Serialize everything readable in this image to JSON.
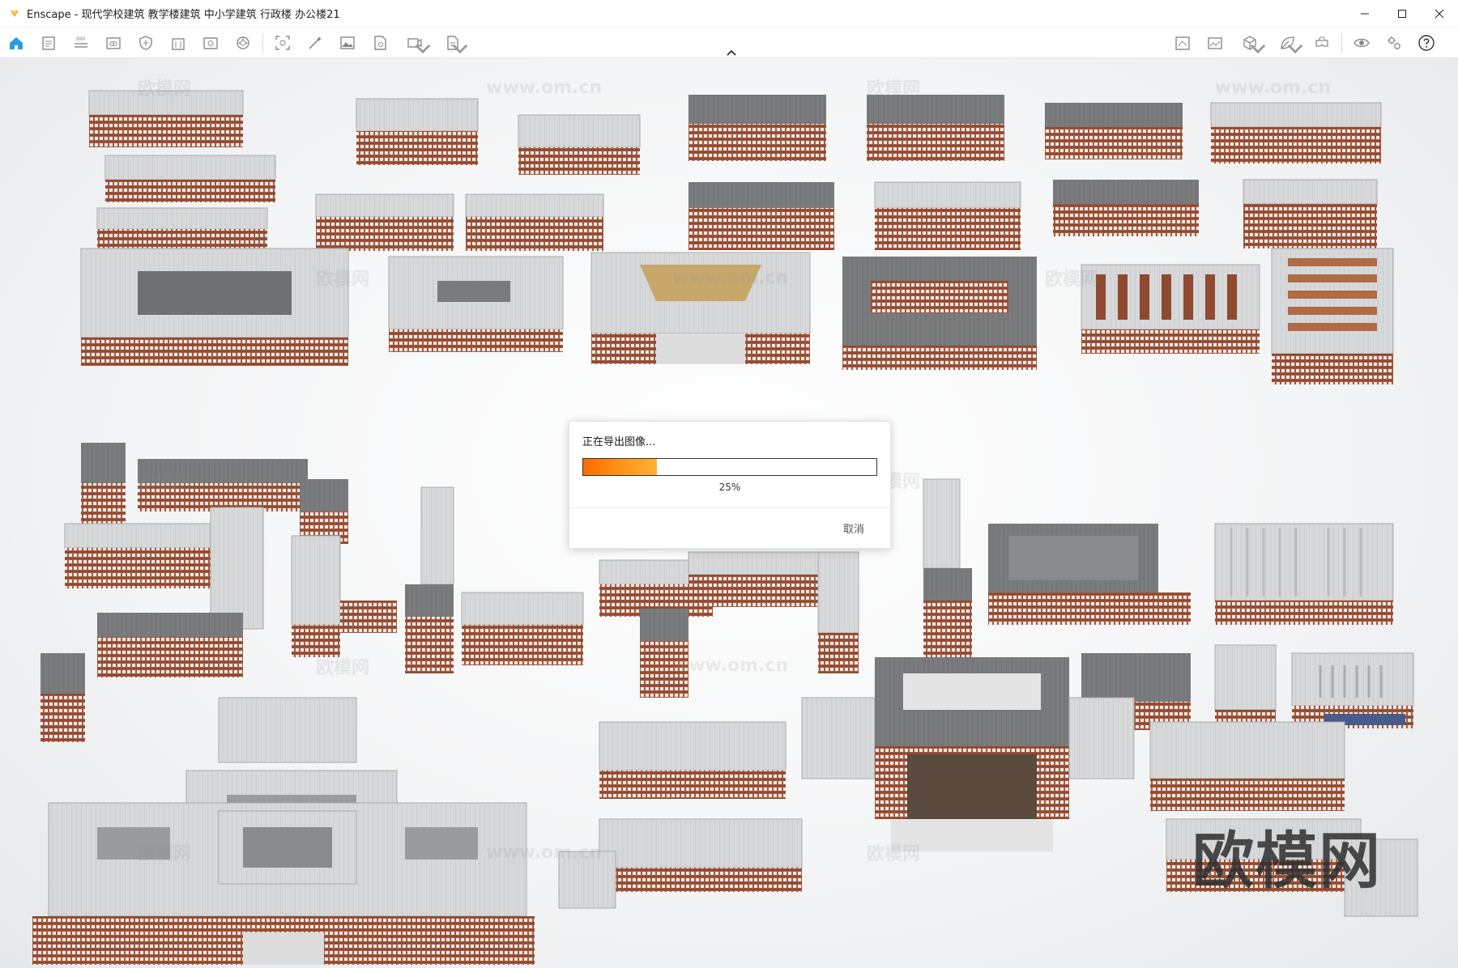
{
  "window": {
    "title": "Enscape - 现代学校建筑 教学楼建筑 中小学建筑 行政楼 办公楼21"
  },
  "icons": {
    "app": "enscape-logo-icon",
    "minimize": "minimize-icon",
    "maximize": "maximize-icon",
    "close": "close-icon",
    "collapse": "chevron-up-icon"
  },
  "toolbar": {
    "left_icons": [
      "home-icon",
      "document-icon",
      "bim-icon",
      "view-eye-icon",
      "shield-icon",
      "building-icon",
      "export-icon",
      "settings-wheel-icon"
    ],
    "mid_icons": [
      "capture-icon",
      "magic-wand-icon",
      "image-icon",
      "file-settings-icon",
      "video-icon",
      "batch-icon"
    ],
    "right_icons": [
      "map-icon",
      "image-library-icon",
      "cube-icon",
      "leaf-icon",
      "vr-icon",
      "eye-icon",
      "gear-icon",
      "help-icon"
    ]
  },
  "dialog": {
    "title": "正在导出图像...",
    "progress_percent": 25,
    "progress_label": "25%",
    "cancel_label": "取消"
  },
  "viewport": {
    "watermark_text": "欧模网",
    "watermark_url": "www.om.cn"
  },
  "colors": {
    "accent": "#1e90ff",
    "progress_start": "#ff6a00",
    "progress_end": "#ffb03a",
    "brick": "#a3593c",
    "roof": "#7a7a7a"
  }
}
